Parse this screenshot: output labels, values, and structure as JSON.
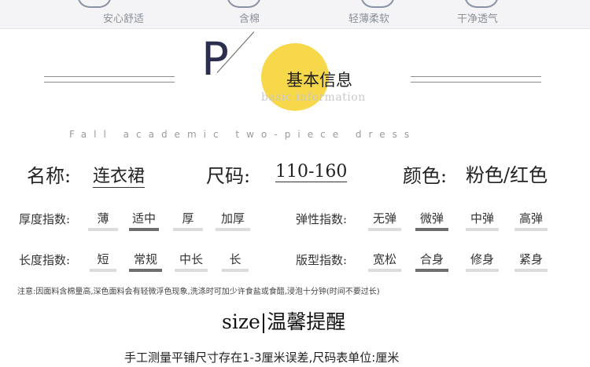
{
  "features": [
    "安心舒适",
    "含棉",
    "轻薄柔软",
    "干净透气"
  ],
  "header": {
    "letter": "P",
    "title_cn": "基本信息",
    "title_en": "basic information",
    "subtitle": "Fall academic two-piece dress"
  },
  "main_info": {
    "name_label": "名称:",
    "name_value": "连衣裙",
    "size_label": "尺码:",
    "size_value": "110-160",
    "color_label": "颜色:",
    "color_value": "粉色/红色"
  },
  "indices": {
    "thickness": {
      "label": "厚度指数:",
      "options": [
        "薄",
        "适中",
        "厚",
        "加厚"
      ],
      "selected": 1
    },
    "elasticity": {
      "label": "弹性指数:",
      "options": [
        "无弹",
        "微弹",
        "中弹",
        "高弹"
      ],
      "selected": 1
    },
    "length": {
      "label": "长度指数:",
      "options": [
        "短",
        "常规",
        "中长",
        "长"
      ],
      "selected": 1
    },
    "fit": {
      "label": "版型指数:",
      "options": [
        "宽松",
        "合身",
        "修身",
        "紧身"
      ],
      "selected": 1
    }
  },
  "notice": "注意:因面料含棉量高,深色面料会有轻微浮色现象,洗涤时可加少许食盐或食醋,浸泡十分钟(时间不要过长)",
  "size_section": {
    "title_en": "size",
    "divider": "|",
    "title_cn": "温馨提醒"
  },
  "bottom_note": "手工测量平铺尺寸存在1-3厘米误差,尺码表单位:厘米"
}
